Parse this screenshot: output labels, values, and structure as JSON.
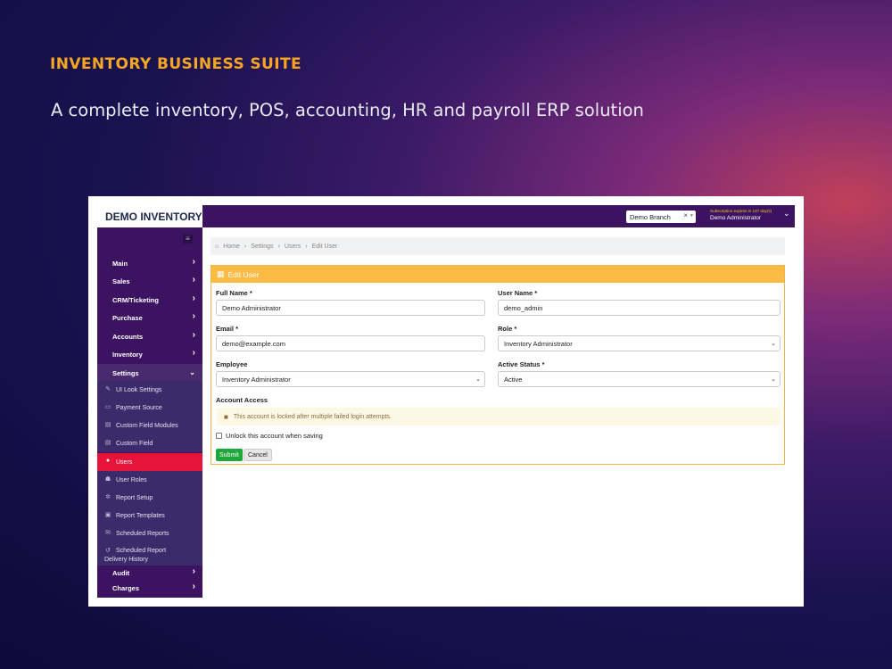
{
  "promo": {
    "title": "INVENTORY BUSINESS SUITE",
    "subtitle": "A complete inventory, POS, accounting, HR and payroll ERP solution"
  },
  "app": {
    "logo": "DEMO INVENTORY",
    "branch_select": "Demo Branch",
    "branch_clear": "×",
    "subscription": "Subscription expires in 137 day(s)",
    "user_name": "Demo Administrator"
  },
  "sidebar": {
    "main_items": [
      {
        "label": "Main",
        "icon": "chevron-right-icon"
      },
      {
        "label": "Sales",
        "icon": "chevron-right-icon"
      },
      {
        "label": "CRM/Ticketing",
        "icon": "chevron-right-icon"
      },
      {
        "label": "Purchase",
        "icon": "chevron-right-icon"
      },
      {
        "label": "Accounts",
        "icon": "chevron-right-icon"
      },
      {
        "label": "Inventory",
        "icon": "chevron-right-icon"
      },
      {
        "label": "Settings",
        "icon": "chevron-down-icon"
      }
    ],
    "settings_items": [
      {
        "label": "UI Look Settings",
        "icon": "pencil-icon"
      },
      {
        "label": "Payment Source",
        "icon": "card-icon"
      },
      {
        "label": "Custom Field Modules",
        "icon": "list-icon"
      },
      {
        "label": "Custom Field",
        "icon": "list-icon"
      },
      {
        "label": "Users",
        "icon": "user-icon"
      },
      {
        "label": "User Roles",
        "icon": "users-icon"
      },
      {
        "label": "Report Setup",
        "icon": "gear-icon"
      },
      {
        "label": "Report Templates",
        "icon": "printer-icon"
      },
      {
        "label": "Scheduled Reports",
        "icon": "envelope-icon"
      },
      {
        "label": "Scheduled Report",
        "label2": "Delivery History",
        "icon": "history-icon"
      }
    ],
    "bottom_items": [
      {
        "label": "Audit",
        "icon": "chevron-right-icon"
      },
      {
        "label": "Charges",
        "icon": "chevron-right-icon"
      }
    ]
  },
  "breadcrumb": [
    "Home",
    "Settings",
    "Users",
    "Edit User"
  ],
  "form": {
    "title": "Edit User",
    "full_name_label": "Full Name *",
    "full_name_value": "Demo Administrator",
    "user_name_label": "User Name *",
    "user_name_value": "demo_admin",
    "email_label": "Email *",
    "email_value": "demo@example.com",
    "role_label": "Role *",
    "role_value": "Inventory Administrator",
    "employee_label": "Employee",
    "employee_value": "Inventory Administrator",
    "active_status_label": "Active Status *",
    "active_status_value": "Active",
    "account_access_label": "Account Access",
    "locked_message": "This account is locked after multiple failed login attempts.",
    "unlock_label": "Unlock this account when saving",
    "submit_label": "Submit",
    "cancel_label": "Cancel"
  }
}
